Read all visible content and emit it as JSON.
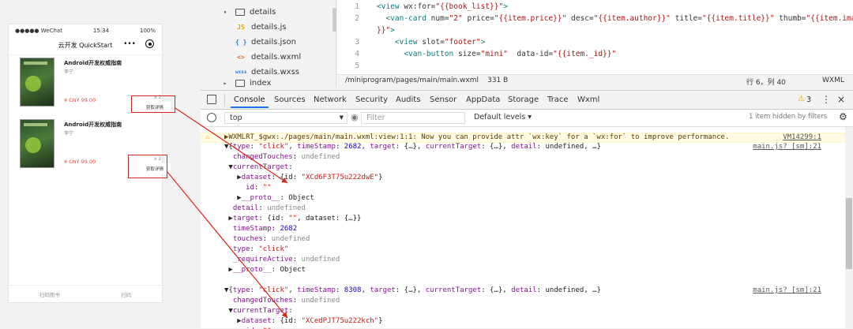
{
  "phone": {
    "carrier": "●●●●● WeChat",
    "time": "15:34",
    "battery": "100%",
    "title": "云开发 QuickStart",
    "menu_icon": "•••",
    "cards": [
      {
        "title": "Android开发权威指南",
        "author": "李宁",
        "price": "¥ CNY 99.00",
        "num": "x 2",
        "button": "获取详情"
      },
      {
        "title": "Android开发权威指南",
        "author": "李宁",
        "price": "¥ CNY 99.00",
        "num": "x 2",
        "button": "获取详情"
      }
    ],
    "tabbar": [
      "扫码图书",
      "扫码"
    ]
  },
  "filetree": {
    "items": [
      {
        "icon": "folder-open-icon",
        "glyph": "▾",
        "name": "details"
      },
      {
        "icon": "js-file-icon",
        "glyph": "JS",
        "name": "details.js"
      },
      {
        "icon": "json-file-icon",
        "glyph": "{ }",
        "name": "details.json"
      },
      {
        "icon": "wxml-file-icon",
        "glyph": "<>",
        "name": "details.wxml"
      },
      {
        "icon": "wxss-file-icon",
        "glyph": "wxss",
        "name": "details.wxss"
      },
      {
        "icon": "folder-icon",
        "glyph": "▸",
        "name": "index"
      }
    ]
  },
  "editor": {
    "lines": [
      {
        "n": "1",
        "html": "<span class='tag'>&lt;view</span> <span class='attr'>wx:for=</span><span class='str'>\"{{book_list}}\"</span><span class='tag'>&gt;</span>"
      },
      {
        "n": "2",
        "html": "&nbsp;&nbsp;<span class='tag'>&lt;van-card</span> <span class='attr'>num=</span><span class='str'>\"2\"</span> <span class='attr'>price=</span><span class='str'>\"{{item.price}}\"</span> <span class='attr'>desc=</span><span class='str'>\"{{item.author}}\"</span> <span class='attr'>title=</span><span class='str'>\"{{item.title}}\"</span> <span class='attr'>thumb=</span><span class='str'>\"{{item.image</span>"
      },
      {
        "n": "",
        "html": "<span class='str'>}}\"</span><span class='tag'>&gt;</span>"
      },
      {
        "n": "3",
        "html": "&nbsp;&nbsp;&nbsp;&nbsp;<span class='tag'>&lt;view</span> <span class='attr'>slot=</span><span class='str'>\"footer\"</span><span class='tag'>&gt;</span>"
      },
      {
        "n": "4",
        "html": "&nbsp;&nbsp;&nbsp;&nbsp;&nbsp;&nbsp;<span class='tag'>&lt;van-button</span> <span class='attr'>size=</span><span class='str'>\"mini\"</span>&nbsp;&nbsp;<span class='attr'>data-id=</span><span class='str'>\"{{item._id}}\"</span>"
      },
      {
        "n": "5",
        "html": ""
      }
    ],
    "file_path": "/miniprogram/pages/main/main.wxml",
    "file_size": "331 B",
    "cursor": "行 6，列 40",
    "lang": "WXML"
  },
  "devtools": {
    "tabs": [
      "Console",
      "Sources",
      "Network",
      "Security",
      "Audits",
      "Sensor",
      "AppData",
      "Storage",
      "Trace",
      "Wxml"
    ],
    "warn_count": "3",
    "context": "top",
    "filter_placeholder": "Filter",
    "levels": "Default levels ▾",
    "hidden": "1 item hidden by filters",
    "rows": [
      {
        "cls": "",
        "html": "<span class='dim'>··· ········ ····· ·········· ··· ·······  ··· ········ ··· ······· ·· ···· ··· · ······</span>",
        "src": ""
      },
      {
        "cls": "warn",
        "html": "▶WXMLRT_$gwx:./pages/main/main.wxml:view:1:1: Now you can provide attr `wx:key` for a `wx:for` to improve performance.",
        "src": "VM14299:1"
      },
      {
        "cls": "",
        "html": "▼{<span class='key'>type</span>: <span class='sv'>\"click\"</span>, <span class='key'>timeStamp</span>: <span class='nv'>2682</span>, <span class='key'>target</span>: {…}, <span class='key'>currentTarget</span>: {…}, <span class='key'>detail</span>: undefined, …}",
        "src": "main.js? [sm]:21"
      },
      {
        "cls": "",
        "html": "&nbsp;&nbsp;<span class='key'>changedTouches</span>: <span class='dim'>undefined</span>",
        "src": ""
      },
      {
        "cls": "",
        "html": "&nbsp;▼<span class='key'>currentTarget</span>:",
        "src": ""
      },
      {
        "cls": "",
        "html": "&nbsp;&nbsp;&nbsp;▶<span class='key'>dataset</span>: {id: <span class='sv'>\"XCd6F3T75u222dwE\"</span>}",
        "src": ""
      },
      {
        "cls": "",
        "html": "&nbsp;&nbsp;&nbsp;&nbsp;&nbsp;<span class='key'>id</span>: <span class='sv'>\"\"</span>",
        "src": ""
      },
      {
        "cls": "",
        "html": "&nbsp;&nbsp;&nbsp;▶<span class='key'>__proto__</span>: Object",
        "src": ""
      },
      {
        "cls": "",
        "html": "&nbsp;&nbsp;<span class='key'>detail</span>: <span class='dim'>undefined</span>",
        "src": ""
      },
      {
        "cls": "",
        "html": "&nbsp;▶<span class='key'>target</span>: {id: <span class='sv'>\"\"</span>, dataset: {…}}",
        "src": ""
      },
      {
        "cls": "",
        "html": "&nbsp;&nbsp;<span class='key'>timeStamp</span>: <span class='nv'>2682</span>",
        "src": ""
      },
      {
        "cls": "",
        "html": "&nbsp;&nbsp;<span class='key'>touches</span>: <span class='dim'>undefined</span>",
        "src": ""
      },
      {
        "cls": "",
        "html": "&nbsp;&nbsp;<span class='key'>type</span>: <span class='sv'>\"click\"</span>",
        "src": ""
      },
      {
        "cls": "",
        "html": "&nbsp;&nbsp;<span class='key'>_requireActive</span>: <span class='dim'>undefined</span>",
        "src": ""
      },
      {
        "cls": "",
        "html": "&nbsp;▶<span class='key'>__proto__</span>: Object",
        "src": ""
      },
      {
        "cls": "",
        "html": "",
        "src": ""
      },
      {
        "cls": "",
        "html": "▼{<span class='key'>type</span>: <span class='sv'>\"click\"</span>, <span class='key'>timeStamp</span>: <span class='nv'>8308</span>, <span class='key'>target</span>: {…}, <span class='key'>currentTarget</span>: {…}, <span class='key'>detail</span>: undefined, …}",
        "src": "main.js? [sm]:21"
      },
      {
        "cls": "",
        "html": "&nbsp;&nbsp;<span class='key'>changedTouches</span>: <span class='dim'>undefined</span>",
        "src": ""
      },
      {
        "cls": "",
        "html": "&nbsp;▼<span class='key'>currentTarget</span>:",
        "src": ""
      },
      {
        "cls": "",
        "html": "&nbsp;&nbsp;&nbsp;▶<span class='key'>dataset</span>: {id: <span class='sv'>\"XCedPJT75u222kch\"</span>}",
        "src": ""
      },
      {
        "cls": "",
        "html": "&nbsp;&nbsp;&nbsp;&nbsp;&nbsp;<span class='key'>id</span>: <span class='sv'>\"\"</span>",
        "src": ""
      }
    ]
  },
  "colors": {
    "accent": "#1a73e8",
    "annotation": "#d9261c",
    "price": "#ff4444",
    "warning_bg": "#fffbe5"
  }
}
